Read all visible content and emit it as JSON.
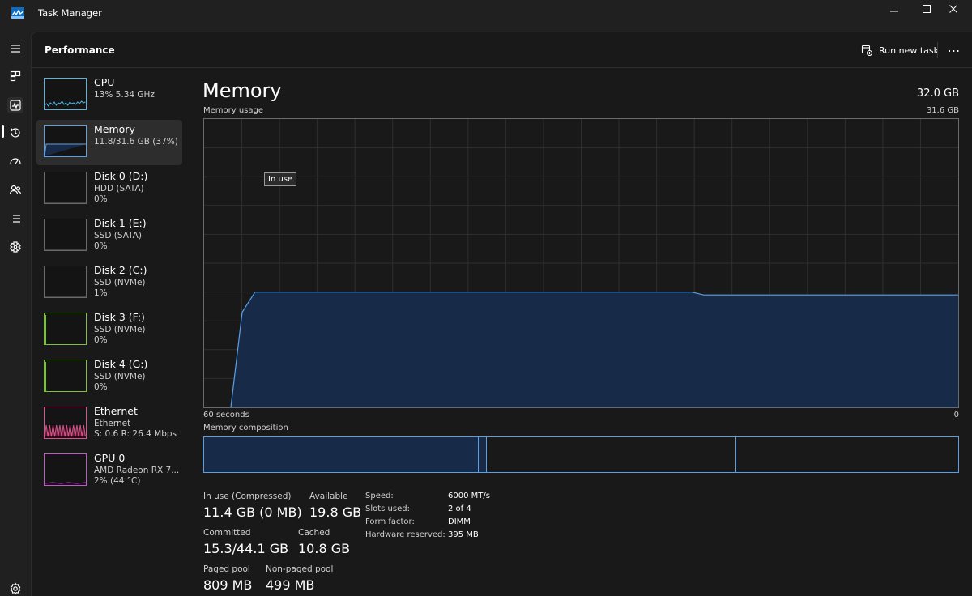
{
  "window": {
    "title": "Task Manager",
    "controls": [
      "minimize",
      "maximize",
      "close"
    ]
  },
  "header": {
    "page_title": "Performance",
    "run_new_task_label": "Run new task",
    "more_label": "⋯"
  },
  "rail": {
    "icons": [
      "hamburger-icon",
      "processes-icon",
      "performance-icon",
      "app-history-icon",
      "startup-apps-icon",
      "users-icon",
      "details-icon",
      "services-icon",
      "settings-icon"
    ]
  },
  "devices": [
    {
      "name": "CPU",
      "sub": "13%  5.34 GHz",
      "sub2": "",
      "color": "#4cb8e8"
    },
    {
      "name": "Memory",
      "sub": "11.8/31.6 GB (37%)",
      "sub2": "",
      "color": "#5aa0e6"
    },
    {
      "name": "Disk 0 (D:)",
      "sub": "HDD (SATA)",
      "sub2": "0%",
      "color": "#6a6a6a"
    },
    {
      "name": "Disk 1 (E:)",
      "sub": "SSD (SATA)",
      "sub2": "0%",
      "color": "#6a6a6a"
    },
    {
      "name": "Disk 2 (C:)",
      "sub": "SSD (NVMe)",
      "sub2": "1%",
      "color": "#6a6a6a"
    },
    {
      "name": "Disk 3 (F:)",
      "sub": "SSD (NVMe)",
      "sub2": "0%",
      "color": "#7ec23a"
    },
    {
      "name": "Disk 4 (G:)",
      "sub": "SSD (NVMe)",
      "sub2": "0%",
      "color": "#7ec23a"
    },
    {
      "name": "Ethernet",
      "sub": "Ethernet",
      "sub2": "S: 0.6  R: 26.4 Mbps",
      "color": "#e0508a"
    },
    {
      "name": "GPU 0",
      "sub": "AMD Radeon RX 7...",
      "sub2": "2%  (44 °C)",
      "color": "#c05ac8"
    }
  ],
  "memory": {
    "title": "Memory",
    "total": "32.0 GB",
    "usage_label": "Memory usage",
    "usage_max": "31.6 GB",
    "tooltip": "In use",
    "axis_left": "60 seconds",
    "axis_right": "0",
    "composition_label": "Memory composition",
    "line_color": "#5aa0e6",
    "fill_color": "#172a48"
  },
  "chart_data": {
    "type": "area",
    "title": "Memory usage",
    "xlabel": "60 seconds",
    "x_range": [
      60,
      0
    ],
    "ylim": [
      0,
      31.6
    ],
    "grid": true,
    "series": [
      {
        "values_fraction": [
          0,
          0.33,
          0.4,
          0.4,
          0.4,
          0.4,
          0.4,
          0.4,
          0.4,
          0.4,
          0.4,
          0.4,
          0.4,
          0.4,
          0.4,
          0.4,
          0.4,
          0.4,
          0.4,
          0.4,
          0.4,
          0.4,
          0.4,
          0.4,
          0.4,
          0.4,
          0.4,
          0.4,
          0.4,
          0.4,
          0.4,
          0.4,
          0.4,
          0.4,
          0.4,
          0.4,
          0.4,
          0.4,
          0.4,
          0.39,
          0.39,
          0.39,
          0.39,
          0.39,
          0.39,
          0.39,
          0.39,
          0.39,
          0.39,
          0.39,
          0.39,
          0.39,
          0.39,
          0.39,
          0.39,
          0.39,
          0.39,
          0.39,
          0.39,
          0.39,
          0.39
        ]
      }
    ],
    "composition": [
      {
        "segment": "in_use",
        "fraction": 0.364,
        "color": "#172a48"
      },
      {
        "segment": "modified",
        "fraction": 0.011,
        "color": "#172a48"
      },
      {
        "segment": "standby",
        "fraction": 0.331,
        "color": "#191919"
      },
      {
        "segment": "free",
        "fraction": 0.294,
        "color": "#191919"
      }
    ]
  },
  "stats": {
    "in_use_label": "In use (Compressed)",
    "in_use_value": "11.4 GB (0 MB)",
    "available_label": "Available",
    "available_value": "19.8 GB",
    "committed_label": "Committed",
    "committed_value": "15.3/44.1 GB",
    "cached_label": "Cached",
    "cached_value": "10.8 GB",
    "paged_label": "Paged pool",
    "paged_value": "809 MB",
    "nonpaged_label": "Non-paged pool",
    "nonpaged_value": "499 MB",
    "speed_label": "Speed:",
    "speed_value": "6000 MT/s",
    "slots_label": "Slots used:",
    "slots_value": "2 of 4",
    "form_label": "Form factor:",
    "form_value": "DIMM",
    "hwres_label": "Hardware reserved:",
    "hwres_value": "395 MB"
  }
}
